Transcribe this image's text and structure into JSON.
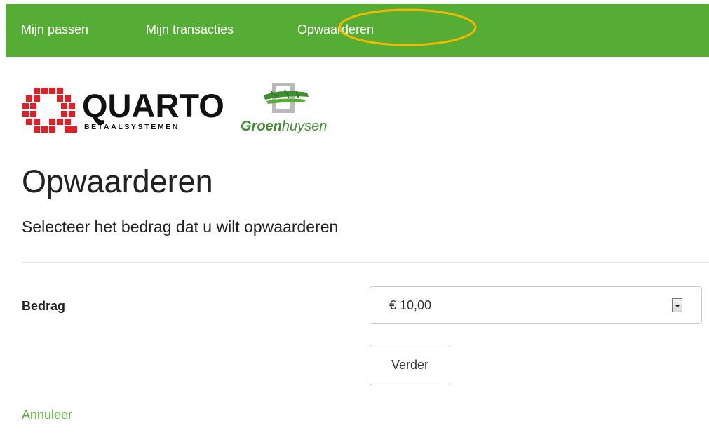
{
  "nav": {
    "items": [
      {
        "label": "Mijn passen"
      },
      {
        "label": "Mijn transacties"
      },
      {
        "label": "Opwaarderen"
      }
    ],
    "bar_color": "#55ad35",
    "highlight_color": "#f5b800"
  },
  "logos": {
    "quarto": {
      "name": "QUARTO",
      "tagline": "BETAALSYSTEMEN",
      "mark_color": "#e31e24"
    },
    "groenhuysen": {
      "name_part1": "Groen",
      "name_part2": "huysen",
      "mark_color": "#3f8f32"
    }
  },
  "page": {
    "title": "Opwaarderen",
    "subtitle": "Selecteer het bedrag dat u wilt opwaarderen"
  },
  "form": {
    "amount_label": "Bedrag",
    "amount_selected": "€ 10,00",
    "submit_label": "Verder",
    "cancel_label": "Annuleer"
  }
}
